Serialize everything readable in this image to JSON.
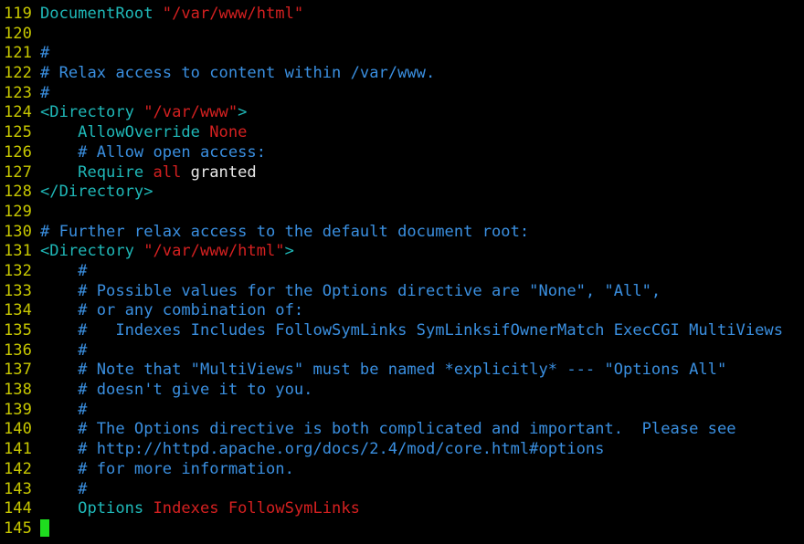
{
  "colors": {
    "background": "#000000",
    "line_number": "#c8c800",
    "keyword": "#1fb8b8",
    "string": "#d42020",
    "comment": "#3a8fe0",
    "text": "#e8e8e8",
    "cursor": "#1fdc1f"
  },
  "lines": [
    {
      "num": "119",
      "tokens": [
        {
          "t": "DocumentRoot ",
          "c": "keyword"
        },
        {
          "t": "\"/var/www/html\"",
          "c": "string"
        }
      ]
    },
    {
      "num": "120",
      "tokens": []
    },
    {
      "num": "121",
      "tokens": [
        {
          "t": "#",
          "c": "comment"
        }
      ]
    },
    {
      "num": "122",
      "tokens": [
        {
          "t": "# Relax access to content within /var/www.",
          "c": "comment"
        }
      ]
    },
    {
      "num": "123",
      "tokens": [
        {
          "t": "#",
          "c": "comment"
        }
      ]
    },
    {
      "num": "124",
      "tokens": [
        {
          "t": "<Directory ",
          "c": "keyword"
        },
        {
          "t": "\"/var/www\"",
          "c": "string"
        },
        {
          "t": ">",
          "c": "keyword"
        }
      ]
    },
    {
      "num": "125",
      "tokens": [
        {
          "t": "    AllowOverride ",
          "c": "keyword"
        },
        {
          "t": "None",
          "c": "string"
        }
      ]
    },
    {
      "num": "126",
      "tokens": [
        {
          "t": "    # Allow open access:",
          "c": "comment"
        }
      ]
    },
    {
      "num": "127",
      "tokens": [
        {
          "t": "    Require ",
          "c": "keyword"
        },
        {
          "t": "all",
          "c": "string"
        },
        {
          "t": " granted",
          "c": "text"
        }
      ]
    },
    {
      "num": "128",
      "tokens": [
        {
          "t": "</Directory>",
          "c": "keyword"
        }
      ]
    },
    {
      "num": "129",
      "tokens": []
    },
    {
      "num": "130",
      "tokens": [
        {
          "t": "# Further relax access to the default document root:",
          "c": "comment"
        }
      ]
    },
    {
      "num": "131",
      "tokens": [
        {
          "t": "<Directory ",
          "c": "keyword"
        },
        {
          "t": "\"/var/www/html\"",
          "c": "string"
        },
        {
          "t": ">",
          "c": "keyword"
        }
      ]
    },
    {
      "num": "132",
      "tokens": [
        {
          "t": "    #",
          "c": "comment"
        }
      ]
    },
    {
      "num": "133",
      "tokens": [
        {
          "t": "    # Possible values for the Options directive are \"None\", \"All\",",
          "c": "comment"
        }
      ]
    },
    {
      "num": "134",
      "tokens": [
        {
          "t": "    # or any combination of:",
          "c": "comment"
        }
      ]
    },
    {
      "num": "135",
      "tokens": [
        {
          "t": "    #   Indexes Includes FollowSymLinks SymLinksifOwnerMatch ExecCGI MultiViews",
          "c": "comment"
        }
      ]
    },
    {
      "num": "136",
      "tokens": [
        {
          "t": "    #",
          "c": "comment"
        }
      ]
    },
    {
      "num": "137",
      "tokens": [
        {
          "t": "    # Note that \"MultiViews\" must be named *explicitly* --- \"Options All\"",
          "c": "comment"
        }
      ]
    },
    {
      "num": "138",
      "tokens": [
        {
          "t": "    # doesn't give it to you.",
          "c": "comment"
        }
      ]
    },
    {
      "num": "139",
      "tokens": [
        {
          "t": "    #",
          "c": "comment"
        }
      ]
    },
    {
      "num": "140",
      "tokens": [
        {
          "t": "    # The Options directive is both complicated and important.  Please see",
          "c": "comment"
        }
      ]
    },
    {
      "num": "141",
      "tokens": [
        {
          "t": "    # http://httpd.apache.org/docs/2.4/mod/core.html#options",
          "c": "comment"
        }
      ]
    },
    {
      "num": "142",
      "tokens": [
        {
          "t": "    # for more information.",
          "c": "comment"
        }
      ]
    },
    {
      "num": "143",
      "tokens": [
        {
          "t": "    #",
          "c": "comment"
        }
      ]
    },
    {
      "num": "144",
      "tokens": [
        {
          "t": "    Options ",
          "c": "keyword"
        },
        {
          "t": "Indexes FollowSymLinks",
          "c": "string"
        }
      ]
    },
    {
      "num": "145",
      "tokens": [],
      "cursor": true
    }
  ]
}
